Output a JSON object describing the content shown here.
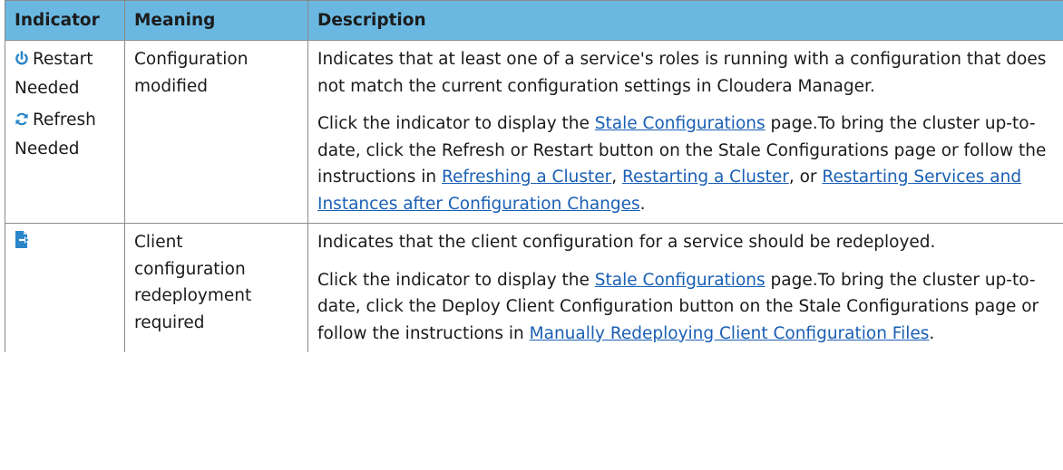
{
  "headers": {
    "indicator": "Indicator",
    "meaning": "Meaning",
    "description": "Description"
  },
  "rows": [
    {
      "indicators": [
        {
          "icon": "power-icon",
          "label": "Restart Needed"
        },
        {
          "icon": "refresh-icon",
          "label": "Refresh Needed"
        }
      ],
      "meaning": "Configuration modified",
      "desc_p1": "Indicates that at least one of a service's roles is running with a configuration that does not match the current configuration settings in Cloudera Manager.",
      "desc_p2": {
        "t1": "Click the indicator to display the ",
        "link1": "Stale Configurations",
        "t2": " page.To bring the cluster up-to-date, click the Refresh or Restart button on the Stale Configurations page or follow the instructions in ",
        "link2": "Refreshing a Cluster",
        "t3": ", ",
        "link3": "Restarting a Cluster",
        "t4": ", or ",
        "link4": "Restarting Services and Instances after Configuration Changes",
        "t5": "."
      }
    },
    {
      "indicators": [
        {
          "icon": "client-config-deploy-icon",
          "label": ""
        }
      ],
      "meaning": "Client configuration redeployment required",
      "desc_p1": "Indicates that the client configuration for a service should be redeployed.",
      "desc_p2": {
        "t1": "Click the indicator to display the ",
        "link1": "Stale Configurations",
        "t2": " page.To bring the cluster up-to-date, click the Deploy Client Configuration button on the Stale Configurations page or follow the instructions in ",
        "link2": "Manually Redeploying Client Configuration Files",
        "t3": "."
      }
    }
  ],
  "colors": {
    "header_bg": "#6ab8e2",
    "link": "#1a5fb4",
    "icon_blue": "#2a86c8"
  }
}
